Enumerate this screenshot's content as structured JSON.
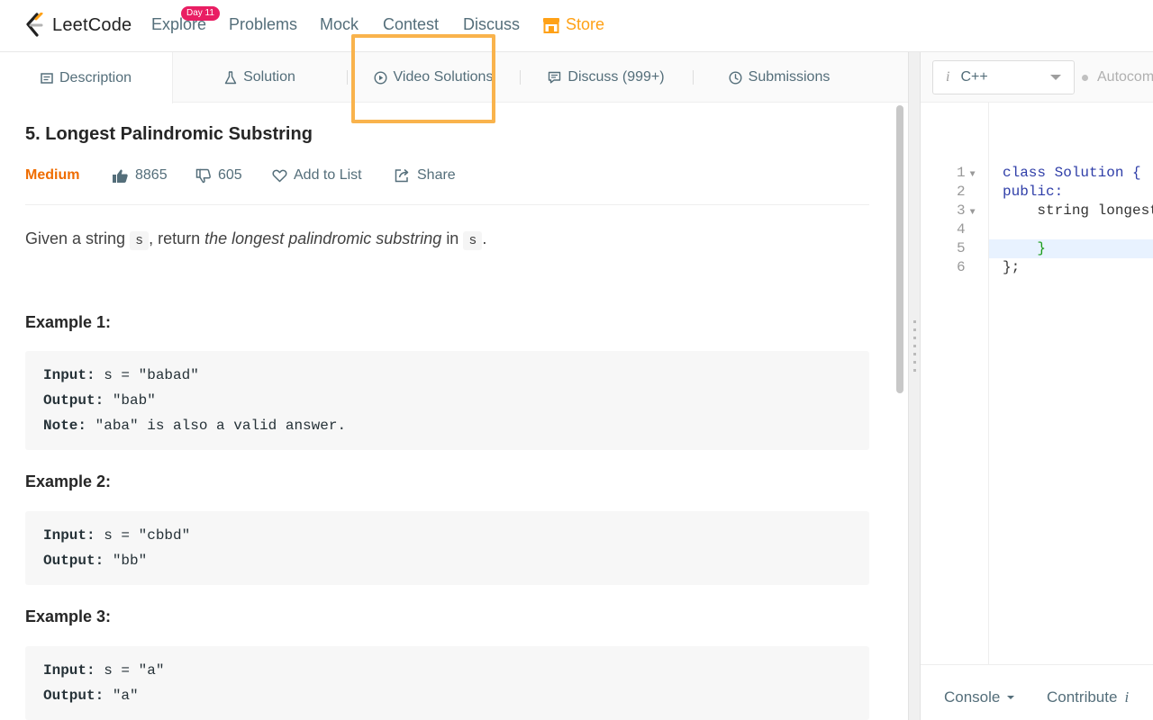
{
  "topnav": {
    "logo_text": "LeetCode",
    "items": [
      "Explore",
      "Problems",
      "Mock",
      "Contest",
      "Discuss"
    ],
    "explore_badge": "Day 11",
    "store_label": "Store",
    "store_color": "#ffa116"
  },
  "tabs": [
    {
      "label": "Description",
      "icon": "description-icon",
      "active": true
    },
    {
      "label": "Solution",
      "icon": "flask-icon",
      "active": false
    },
    {
      "label": "Video Solutions",
      "icon": "play-circle-icon",
      "active": false,
      "highlighted": true
    },
    {
      "label": "Discuss (999+)",
      "icon": "comment-icon",
      "active": false
    },
    {
      "label": "Submissions",
      "icon": "clock-icon",
      "active": false
    }
  ],
  "problem": {
    "title": "5. Longest Palindromic Substring",
    "difficulty": "Medium",
    "likes": "8865",
    "dislikes": "605",
    "add_to_list": "Add to List",
    "share": "Share",
    "desc_prefix": "Given a string",
    "desc_var": "s",
    "desc_mid": ", return",
    "desc_em": "the longest palindromic substring",
    "desc_in": "in",
    "desc_end": "."
  },
  "examples": [
    {
      "title": "Example 1:",
      "lines": [
        [
          "Input:",
          " s = \"babad\""
        ],
        [
          "Output:",
          " \"bab\""
        ],
        [
          "Note:",
          " \"aba\" is also a valid answer."
        ]
      ]
    },
    {
      "title": "Example 2:",
      "lines": [
        [
          "Input:",
          " s = \"cbbd\""
        ],
        [
          "Output:",
          " \"bb\""
        ]
      ]
    },
    {
      "title": "Example 3:",
      "lines": [
        [
          "Input:",
          " s = \"a\""
        ],
        [
          "Output:",
          " \"a\""
        ]
      ]
    }
  ],
  "editor": {
    "language": "C++",
    "autocomplete_label": "Autocomplete",
    "line_numbers": [
      "1",
      "2",
      "3",
      "4",
      "5",
      "6"
    ],
    "code_lines": {
      "l1_kw": "class",
      "l1_rest": " Solution {",
      "l2": "public:",
      "l3": "    string longestPalindrome(string s) {",
      "l4": "",
      "l5": "    }",
      "l6": "};"
    },
    "console_label": "Console",
    "contribute_label": "Contribute"
  },
  "colors": {
    "accent": "#ffa116",
    "medium": "#ef6c00",
    "highlight_box": "#f9b34c"
  }
}
